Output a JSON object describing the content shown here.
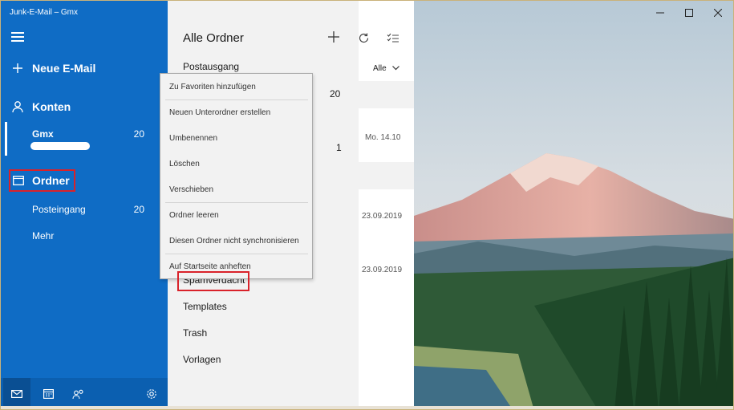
{
  "window": {
    "title": "Junk-E-Mail – Gmx"
  },
  "sidebar": {
    "new_mail": "Neue E-Mail",
    "accounts_label": "Konten",
    "account": {
      "name": "Gmx",
      "count": "20"
    },
    "folders_label": "Ordner",
    "folder_items": [
      {
        "label": "Posteingang",
        "count": "20"
      },
      {
        "label": "Mehr",
        "count": ""
      }
    ],
    "bottom_icons": [
      "mail-icon",
      "calendar-icon",
      "people-icon",
      "settings-icon"
    ]
  },
  "folder_pane": {
    "title": "Alle Ordner",
    "items": [
      "Postausgang",
      "Spamverdacht",
      "Templates",
      "Trash",
      "Vorlagen"
    ]
  },
  "message_list": {
    "filter": "Alle",
    "counts": [
      "20",
      "1"
    ],
    "dates": [
      "Mo. 14.10",
      "23.09.2019",
      "23.09.2019"
    ]
  },
  "context_menu": {
    "items": [
      "Zu Favoriten hinzufügen",
      "Neuen Unterordner erstellen",
      "Umbenennen",
      "Löschen",
      "Verschieben",
      "Ordner leeren",
      "Diesen Ordner nicht synchronisieren",
      "Auf Startseite anheften"
    ]
  },
  "colors": {
    "sidebar": "#0f6cc5",
    "highlight": "#d9222a",
    "pane": "#f2f2f2"
  }
}
